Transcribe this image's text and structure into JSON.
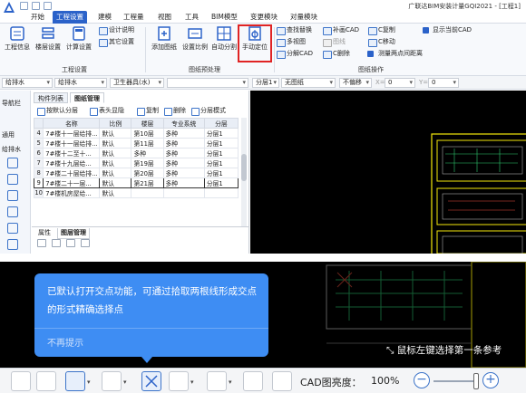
{
  "titlebar": {
    "app_title": "广联达BIM安装计量GQI2021 - [工程1]",
    "menu": [
      "开始",
      "工程设置",
      "建模",
      "工程量",
      "视图",
      "工具",
      "BIM模型",
      "变更模块",
      "对量模块"
    ],
    "active_menu": "工程设置"
  },
  "ribbon": {
    "project_group": {
      "label": "工程设置",
      "big_buttons": [
        "工程信息",
        "楼层设置",
        "计算设置"
      ],
      "small_buttons": [
        "设计说明",
        "其它设置"
      ]
    },
    "drawing_group": {
      "label": "图纸预处理",
      "big_buttons": [
        "添加图纸",
        "设置比例",
        "自动分割",
        "手动定位"
      ]
    },
    "layer_group": {
      "label": "图纸操作",
      "small_buttons": [
        "查找替换",
        "多视图",
        "分解CAD",
        "补画CAD",
        "图线",
        "C删除",
        "C复制",
        "C移动"
      ],
      "checkboxes": [
        "显示当前CAD",
        "测量两点间距离"
      ]
    },
    "highlighted_button": "手动定位"
  },
  "selector_bar": {
    "fields": [
      "给排水",
      "给排水",
      "卫生器具(水)",
      "",
      "分层1",
      "无图纸"
    ],
    "mode": "不偏移",
    "x_label": "X=",
    "x_value": "0",
    "y_label": "Y=",
    "y_value": "0"
  },
  "leftnav": {
    "title": "导航栏",
    "section_title": "通用",
    "active_item": "给排水"
  },
  "drawing_panel": {
    "tabs": [
      "构件列表",
      "图纸管理"
    ],
    "active_tab": "图纸管理",
    "toolbar": [
      "按默认分层",
      "表头显隐",
      "复制",
      "删除",
      "分层模式"
    ],
    "columns": [
      "名称",
      "比例",
      "楼层",
      "专业系统",
      "分层"
    ],
    "rows": [
      [
        "7#楼十一层给排...",
        "默认",
        "第10层",
        "多种",
        "分层1"
      ],
      [
        "7#楼十一层给排...",
        "默认",
        "第11层",
        "多种",
        "分层1"
      ],
      [
        "7#楼十二至十...",
        "默认",
        "多种",
        "多种",
        "分层1"
      ],
      [
        "7#楼十九层给...",
        "默认",
        "第19层",
        "多种",
        "分层1"
      ],
      [
        "7#楼二十层给排...",
        "默认",
        "第20层",
        "多种",
        "分层1"
      ],
      [
        "7#楼二十一层...",
        "默认",
        "第21层",
        "多种",
        "分层1"
      ],
      [
        "7#楼机房屋给...",
        "默认",
        "",
        "",
        ""
      ]
    ],
    "row_numbers": [
      "4",
      "5",
      "6",
      "7",
      "8",
      "9",
      "10"
    ],
    "selected_row": 5,
    "bottom_tabs": [
      "属性",
      "图层管理"
    ],
    "active_bottom_tab": "图层管理"
  },
  "tooltip": {
    "text": "已默认打开交点功能，可通过拾取两根线形成交点的形式精确选择点",
    "dismiss": "不再提示"
  },
  "status_hint": "鼠标左键选择第一条参考",
  "bottom_toolbar": {
    "cad_brightness_label": "CAD图亮度：",
    "cad_brightness_value": "100%",
    "brightness_level": 1.0
  },
  "colors": {
    "brand_blue": "#2b62c9",
    "tooltip_blue": "#3e8df3",
    "highlight_red": "#e02424",
    "cad_bg": "#000000"
  }
}
